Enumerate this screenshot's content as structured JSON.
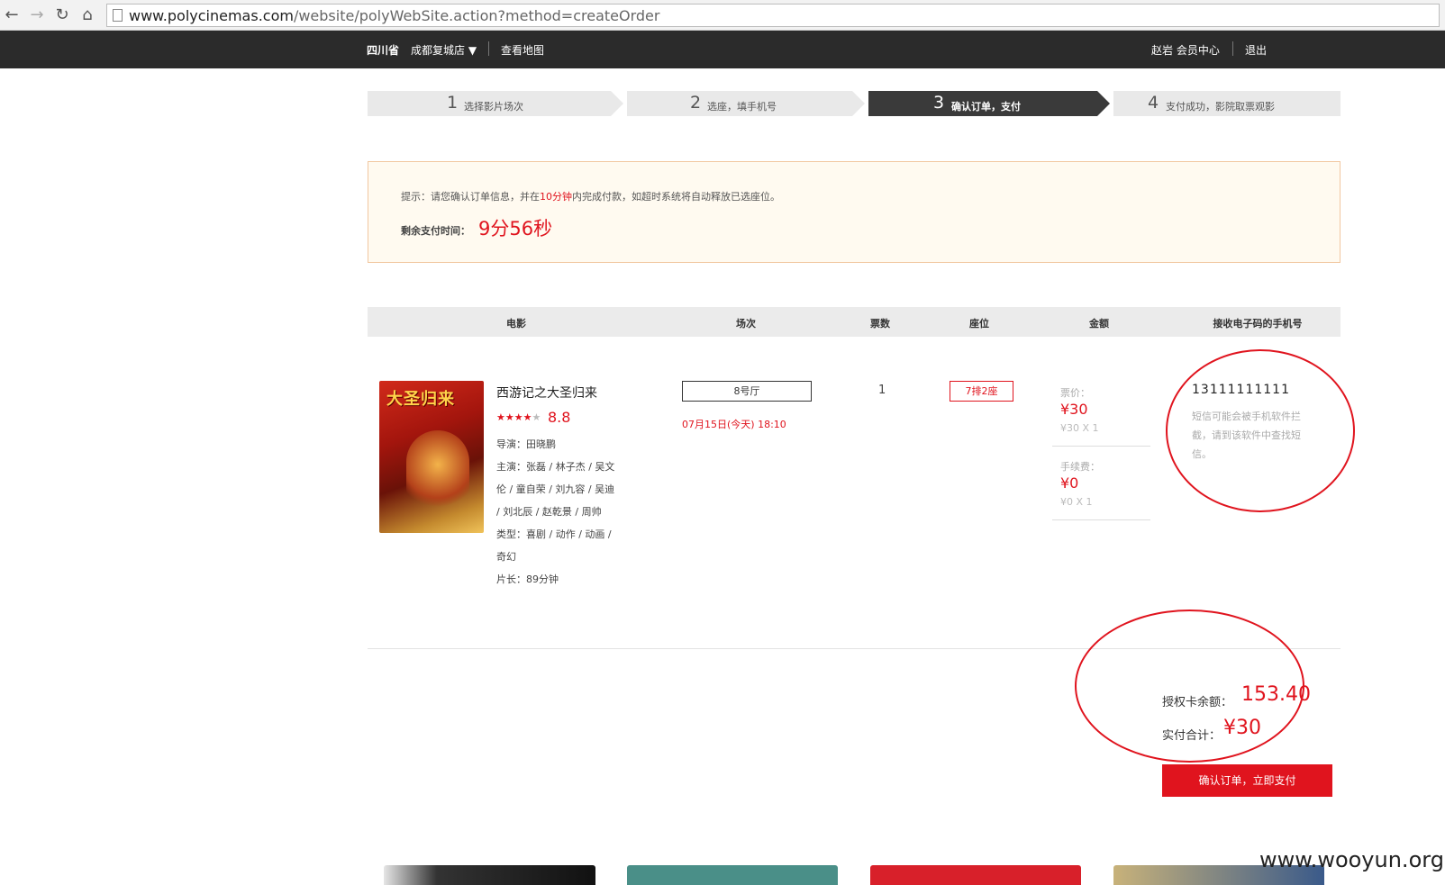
{
  "browser": {
    "url_host": "www.polycinemas.com",
    "url_path": "/website/polyWebSite.action?method=createOrder"
  },
  "topnav": {
    "province": "四川省",
    "store": "成都复城店 ▼",
    "map": "查看地图",
    "user": "赵岩 会员中心",
    "logout": "退出"
  },
  "steps": [
    {
      "num": "1",
      "label": "选择影片场次"
    },
    {
      "num": "2",
      "label": "选座，填手机号"
    },
    {
      "num": "3",
      "label": "确认订单，支付"
    },
    {
      "num": "4",
      "label": "支付成功，影院取票观影"
    }
  ],
  "notice": {
    "tip_before": "提示：请您确认订单信息，并在",
    "tip_red": "10分钟",
    "tip_after": "内完成付款，如超时系统将自动释放已选座位。",
    "remain_label": "剩余支付时间：",
    "remain_value": "9分56秒"
  },
  "table_headers": [
    "电影",
    "场次",
    "票数",
    "座位",
    "金额",
    "接收电子码的手机号"
  ],
  "movie": {
    "poster_title": "大圣归来",
    "title": "西游记之大圣归来",
    "stars_filled": "★★★★",
    "stars_empty": "★",
    "rating": 4,
    "score": "8.8",
    "info_lines": [
      "导演：田晓鹏",
      "主演：张磊 / 林子杰 / 吴文",
      "伦 / 童自荣 / 刘九容 / 吴迪",
      "/ 刘北辰 / 赵乾景 / 周帅",
      "类型：喜剧 / 动作 / 动画 /",
      "奇幻",
      "片长：89分钟"
    ]
  },
  "session": {
    "hall": "8号厅",
    "time": "07月15日(今天) 18:10"
  },
  "ticket_count": "1",
  "seat": "7排2座",
  "amount": {
    "price_label": "票价：",
    "price_value": "¥30",
    "price_detail": "¥30 X 1",
    "fee_label": "手续费：",
    "fee_value": "¥0",
    "fee_detail": "¥0 X 1"
  },
  "phone": {
    "number": "13111111111",
    "note": "短信可能会被手机软件拦截，请到该软件中查找短信。"
  },
  "summary": {
    "balance_label": "授权卡余额：",
    "balance_value": "153.40",
    "total_label": "实付合计：",
    "total_value": "¥30"
  },
  "pay_button": "确认订单，立即支付",
  "watermark": "www.wooyun.org",
  "colors": {
    "accent": "#e0141e",
    "nav_bg": "#2b2b2b",
    "step_active": "#3a3a3a",
    "notice_bg": "#fffaf0"
  }
}
